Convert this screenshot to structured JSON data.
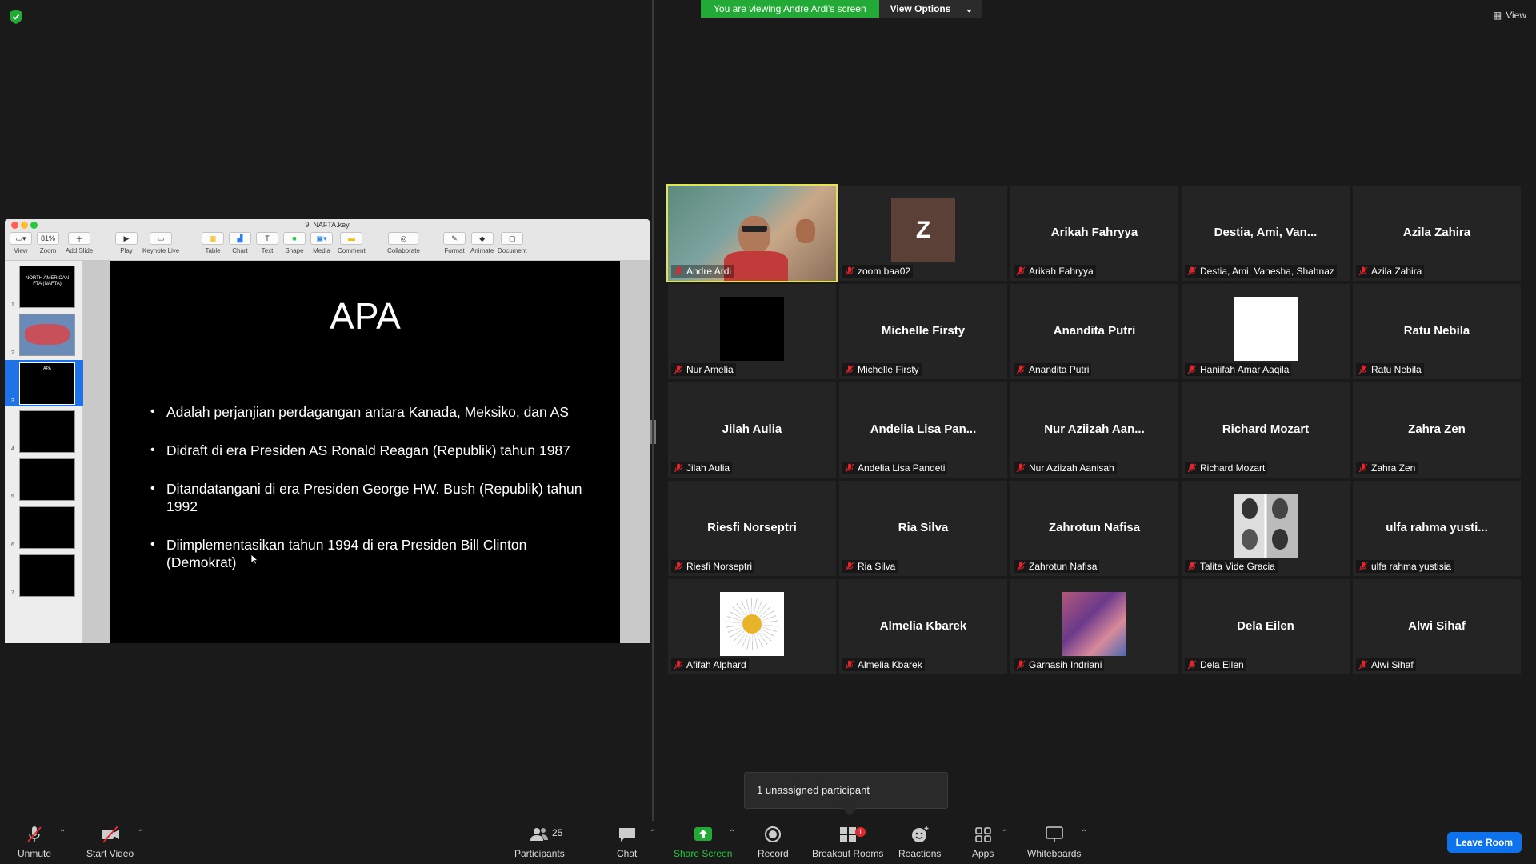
{
  "share": {
    "banner_text": "You are viewing Andre Ardi's screen",
    "view_options_label": "View Options",
    "view_label": "View"
  },
  "keynote": {
    "doc_title": "9. NAFTA.key",
    "zoom_value": "81%",
    "toolbar": {
      "view": "View",
      "zoom": "Zoom",
      "add_slide": "Add Slide",
      "play": "Play",
      "keynote_live": "Keynote Live",
      "table": "Table",
      "chart": "Chart",
      "text": "Text",
      "shape": "Shape",
      "media": "Media",
      "comment": "Comment",
      "collaborate": "Collaborate",
      "format": "Format",
      "animate": "Animate",
      "document": "Document"
    },
    "thumbnails": [
      "1",
      "2",
      "3",
      "4",
      "5",
      "6",
      "7"
    ],
    "selected_slide": 3,
    "slide": {
      "title": "APA",
      "bullets": [
        "Adalah perjanjian perdagangan antara Kanada, Meksiko, dan AS",
        "Didraft di era Presiden AS Ronald Reagan (Republik) tahun 1987",
        "Ditandatangani di era Presiden George HW. Bush (Republik) tahun 1992",
        "Diimplementasikan tahun 1994 di era Presiden Bill Clinton (Demokrat)"
      ]
    }
  },
  "gallery": {
    "tiles": [
      {
        "name": "",
        "label": "Andre Ardi",
        "type": "video"
      },
      {
        "name": "",
        "label": "zoom baa02",
        "type": "letter",
        "letter": "Z"
      },
      {
        "name": "Arikah Fahryya",
        "label": "Arikah Fahryya",
        "type": "name"
      },
      {
        "name": "Destia, Ami, Van...",
        "label": "Destia, Ami, Vanesha, Shahnaz",
        "type": "name"
      },
      {
        "name": "Azila Zahira",
        "label": "Azila Zahira",
        "type": "name"
      },
      {
        "name": "",
        "label": "Nur Amelia",
        "type": "black"
      },
      {
        "name": "Michelle Firsty",
        "label": "Michelle Firsty",
        "type": "name"
      },
      {
        "name": "Anandita Putri",
        "label": "Anandita Putri",
        "type": "name"
      },
      {
        "name": "",
        "label": "Haniifah Amar Aaqila",
        "type": "white"
      },
      {
        "name": "Ratu Nebila",
        "label": "Ratu Nebila",
        "type": "name"
      },
      {
        "name": "Jilah Aulia",
        "label": "Jilah Aulia",
        "type": "name"
      },
      {
        "name": "Andelia Lisa Pan...",
        "label": "Andelia Lisa Pandeti",
        "type": "name"
      },
      {
        "name": "Nur Aziizah Aan...",
        "label": "Nur Aziizah Aanisah",
        "type": "name"
      },
      {
        "name": "Richard Mozart",
        "label": "Richard Mozart",
        "type": "name"
      },
      {
        "name": "Zahra Zen",
        "label": "Zahra Zen",
        "type": "name"
      },
      {
        "name": "Riesfi Norseptri",
        "label": "Riesfi Norseptri",
        "type": "name"
      },
      {
        "name": "Ria Silva",
        "label": "Ria Silva",
        "type": "name"
      },
      {
        "name": "Zahrotun Nafisa",
        "label": "Zahrotun Nafisa",
        "type": "name"
      },
      {
        "name": "",
        "label": "Talita Vide Gracia",
        "type": "photo"
      },
      {
        "name": "ulfa rahma yusti...",
        "label": "ulfa rahma yustisia",
        "type": "name"
      },
      {
        "name": "",
        "label": "Afifah Alphard",
        "type": "flower"
      },
      {
        "name": "Almelia Kbarek",
        "label": "Almelia Kbarek",
        "type": "name"
      },
      {
        "name": "",
        "label": "Garnasih Indriani",
        "type": "collage"
      },
      {
        "name": "Dela Eilen",
        "label": "Dela Eilen",
        "type": "name"
      },
      {
        "name": "Alwi Sihaf",
        "label": "Alwi Sihaf",
        "type": "name"
      }
    ]
  },
  "toast": "1 unassigned participant",
  "toolbar": {
    "unmute": "Unmute",
    "start_video": "Start Video",
    "participants": "Participants",
    "participants_count": "25",
    "chat": "Chat",
    "share_screen": "Share Screen",
    "record": "Record",
    "breakout_rooms": "Breakout Rooms",
    "breakout_badge": "1",
    "reactions": "Reactions",
    "apps": "Apps",
    "whiteboards": "Whiteboards",
    "leave": "Leave Room"
  },
  "colors": {
    "accent_green": "#23a935",
    "active_speaker": "#e2e54c",
    "leave_blue": "#0e72ed",
    "muted_red": "#e0262e"
  }
}
